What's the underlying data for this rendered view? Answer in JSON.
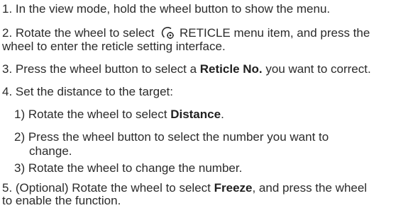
{
  "steps": {
    "s1": "1. In the view mode, hold the wheel button to show the menu.",
    "s2a_pre": "2. Rotate the wheel to select ",
    "s2a_icon": "reticle-icon",
    "s2a_post": " RETICLE menu item, and press the",
    "s2b": "wheel to enter the reticle setting interface.",
    "s3_pre": "3. Press the wheel button to select a ",
    "s3_bold": "Reticle No.",
    "s3_post": " you want to correct.",
    "s4": "4. Set the distance to the target:",
    "s4_1_pre": "1) Rotate the wheel to select ",
    "s4_1_bold": "Distance",
    "s4_1_post": ".",
    "s4_2a": "2) Press the wheel button to select the number you want to",
    "s4_2b": "change.",
    "s4_3": "3) Rotate the wheel to change the number.",
    "s5a_pre": "5. (Optional) Rotate the wheel to select ",
    "s5a_bold": "Freeze",
    "s5a_post": ", and press the wheel",
    "s5b": "to enable the function."
  }
}
